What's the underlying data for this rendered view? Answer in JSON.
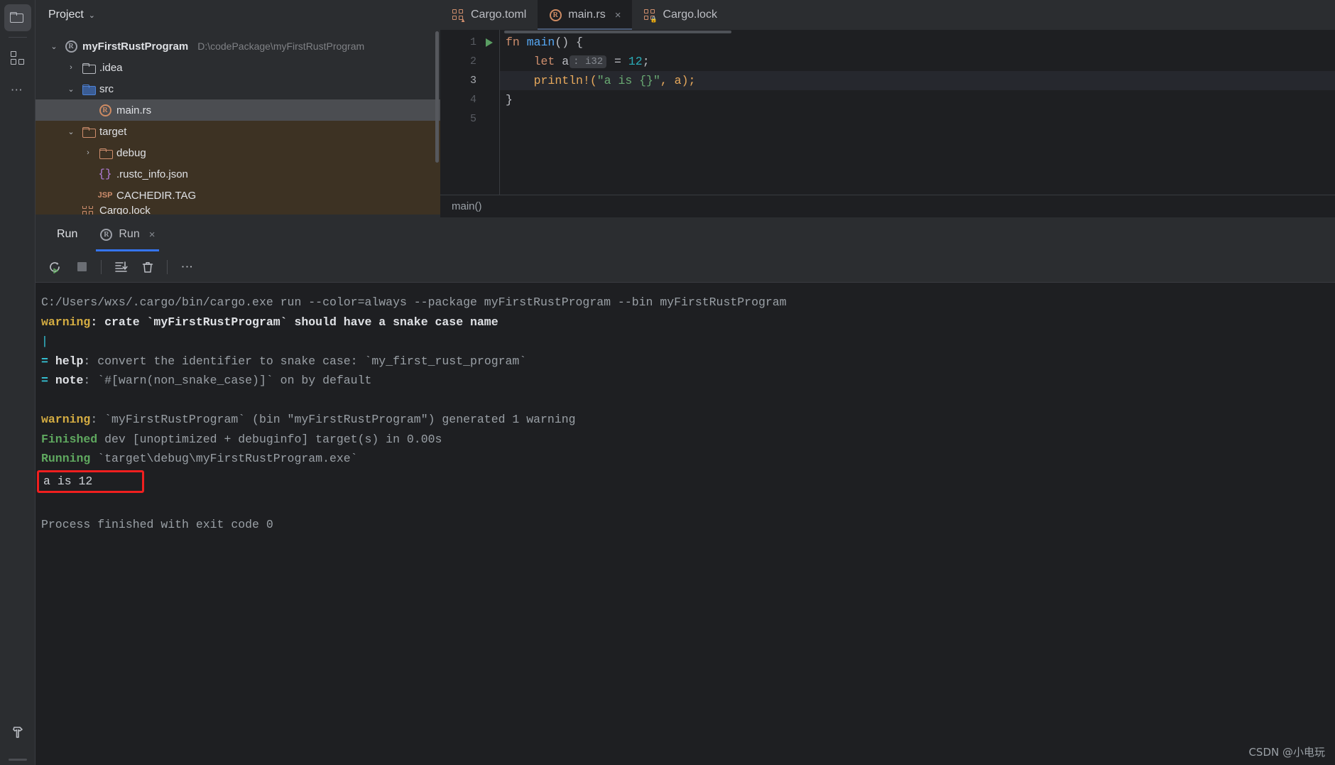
{
  "rail": {
    "items": [
      {
        "name": "project-folder-icon",
        "label": "Project",
        "active": true
      },
      {
        "name": "structure-icon",
        "label": "Structure",
        "active": false
      },
      {
        "name": "more-tool-windows-icon",
        "label": "More",
        "active": false
      }
    ],
    "bottom": {
      "name": "build-hammer-icon",
      "label": "Build"
    }
  },
  "project": {
    "title": "Project",
    "chevron": "⌄",
    "tree": [
      {
        "indent": 0,
        "arrow": "⌄",
        "icon": "rust-project-icon",
        "label": "myFirstRustProgram",
        "path": "D:\\codePackage\\myFirstRustProgram",
        "bold": true,
        "state": "normal"
      },
      {
        "indent": 1,
        "arrow": "›",
        "icon": "folder-grey-icon",
        "label": ".idea",
        "path": "",
        "bold": false,
        "state": "normal"
      },
      {
        "indent": 1,
        "arrow": "⌄",
        "icon": "folder-blue-icon",
        "label": "src",
        "path": "",
        "bold": false,
        "state": "normal"
      },
      {
        "indent": 2,
        "arrow": "",
        "icon": "rust-file-icon",
        "label": "main.rs",
        "path": "",
        "bold": false,
        "state": "selected"
      },
      {
        "indent": 1,
        "arrow": "⌄",
        "icon": "folder-orange-icon",
        "label": "target",
        "path": "",
        "bold": false,
        "state": "target"
      },
      {
        "indent": 2,
        "arrow": "›",
        "icon": "folder-orange-icon",
        "label": "debug",
        "path": "",
        "bold": false,
        "state": "target"
      },
      {
        "indent": 2,
        "arrow": "",
        "icon": "json-file-icon",
        "label": ".rustc_info.json",
        "path": "",
        "bold": false,
        "state": "target"
      },
      {
        "indent": 2,
        "arrow": "",
        "icon": "jsp-file-icon",
        "label": "CACHEDIR.TAG",
        "path": "",
        "bold": false,
        "state": "target"
      },
      {
        "indent": 1,
        "arrow": "",
        "icon": "toml-file-icon",
        "label": "Cargo.lock",
        "path": "",
        "bold": false,
        "state": "cut"
      }
    ]
  },
  "editor": {
    "tabs": [
      {
        "label": "Cargo.toml",
        "icon": "cargo-toml-icon",
        "active": false,
        "closable": false
      },
      {
        "label": "main.rs",
        "icon": "rust-file-icon",
        "active": true,
        "closable": true,
        "close": "×"
      },
      {
        "label": "Cargo.lock",
        "icon": "cargo-lock-icon",
        "active": false,
        "closable": false
      }
    ],
    "gutter_lines": [
      "1",
      "2",
      "3",
      "4",
      "5"
    ],
    "current_line": 3,
    "run_marker_line": 1,
    "code": {
      "line1": {
        "kw": "fn ",
        "fn": "main",
        "pl": "() {"
      },
      "line2": {
        "kw": "let",
        "var": " a",
        "hint": ": i32",
        "rest": " = ",
        "num": "12",
        "semi": ";"
      },
      "line3": {
        "macro": "println!",
        "open": "(",
        "str": "\"a is {}\"",
        "mid": ", a",
        "close": ");"
      },
      "line4": "}",
      "line5": ""
    },
    "breadcrumb": "main()"
  },
  "run": {
    "window_title": "Run",
    "tab": {
      "label": "Run",
      "icon": "rust-run-icon",
      "close": "×"
    },
    "toolbar": [
      {
        "name": "rerun-button",
        "glyph": "rerun"
      },
      {
        "name": "stop-button",
        "glyph": "stop"
      },
      {
        "name": "scroll-to-end-button",
        "glyph": "scroll-end"
      },
      {
        "name": "clear-all-button",
        "glyph": "trash"
      },
      {
        "name": "more-options-button",
        "glyph": "kebab"
      }
    ],
    "console": {
      "command": "C:/Users/wxs/.cargo/bin/cargo.exe run --color=always --package myFirstRustProgram --bin myFirstRustProgram",
      "warning1_label": "warning",
      "warning1_text": ": crate `myFirstRustProgram` should have a snake case name",
      "pipe": "|",
      "help_eq": "=",
      "help_label": "help",
      "help_text": ": convert the identifier to snake case: `my_first_rust_program`",
      "note_eq": "=",
      "note_label": "note",
      "note_text": ": `#[warn(non_snake_case)]` on by default",
      "warning2_label": "warning",
      "warning2_text": ": `myFirstRustProgram` (bin \"myFirstRustProgram\") generated 1 warning",
      "finished_label": "Finished",
      "finished_text": " dev [unoptimized + debuginfo] target(s) in 0.00s",
      "running_label": "Running",
      "running_text": " `target\\debug\\myFirstRustProgram.exe`",
      "program_output": "a is 12",
      "process_finished": "Process finished with exit code 0"
    }
  },
  "watermark": "CSDN @小电玩",
  "colors": {
    "bg": "#2b2d30",
    "editor_bg": "#1e1f22",
    "accent_blue": "#3574f0",
    "rust_orange": "#cf8e6d",
    "warning_yellow": "#d4ac42",
    "success_green": "#5fa85f",
    "annotation_red": "#f01f1f",
    "target_folder_bg": "#3d3223"
  }
}
